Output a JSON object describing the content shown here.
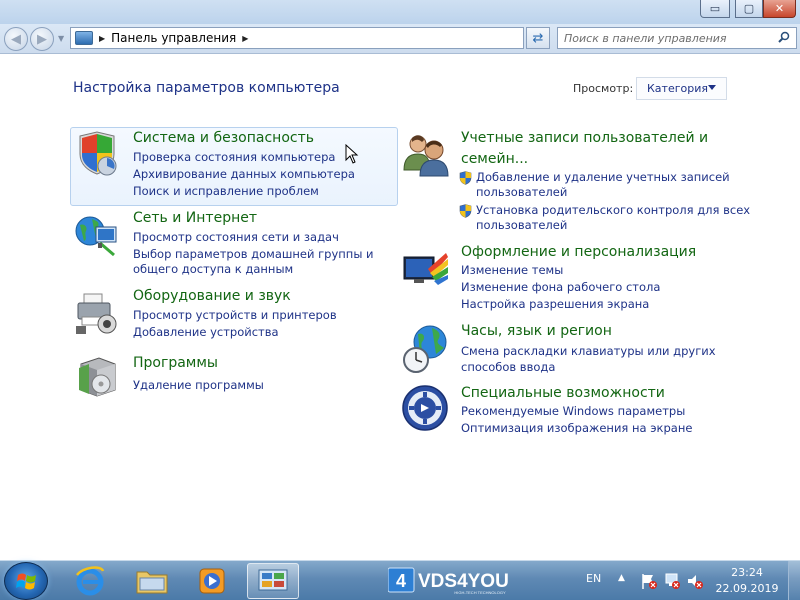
{
  "window": {
    "controls": {
      "minimize": "▭",
      "maximize": "▢",
      "close": "✕"
    }
  },
  "nav": {
    "address_path": "Панель управления",
    "search_placeholder": "Поиск в панели управления"
  },
  "header": {
    "title": "Настройка параметров компьютера",
    "view_label": "Просмотр:",
    "view_value": "Категория"
  },
  "categories": {
    "system": {
      "title": "Система и безопасность",
      "links": [
        "Проверка состояния компьютера",
        "Архивирование данных компьютера",
        "Поиск и исправление проблем"
      ]
    },
    "network": {
      "title": "Сеть и Интернет",
      "links": [
        "Просмотр состояния сети и задач",
        "Выбор параметров домашней группы и",
        "общего доступа к данным"
      ]
    },
    "hardware": {
      "title": "Оборудование и звук",
      "links": [
        "Просмотр устройств и принтеров",
        "Добавление устройства"
      ]
    },
    "programs": {
      "title": "Программы",
      "links": [
        "Удаление программы"
      ]
    },
    "accounts": {
      "title_line1": "Учетные записи пользователей и",
      "title_line2": "семейн...",
      "links": [
        "Добавление и удаление учетных записей",
        "пользователей",
        "Установка родительского контроля для всех",
        "пользователей"
      ]
    },
    "appearance": {
      "title": "Оформление и персонализация",
      "links": [
        "Изменение темы",
        "Изменение фона рабочего стола",
        "Настройка разрешения экрана"
      ]
    },
    "clock": {
      "title": "Часы, язык и регион",
      "links": [
        "Смена раскладки клавиатуры или других",
        "способов ввода"
      ]
    },
    "access": {
      "title": "Специальные возможности",
      "links": [
        "Рекомендуемые Windows параметры",
        "Оптимизация изображения на экране"
      ]
    }
  },
  "taskbar": {
    "brand": "VDS4YOU",
    "brand_prefix": "4",
    "brand_tagline": "HIGH-TECH TECHNOLOGY",
    "language": "EN",
    "time": "23:24",
    "date": "22.09.2019"
  },
  "colors": {
    "link": "#1e3287",
    "category_title": "#136613",
    "taskbar": "#5f89b4"
  }
}
